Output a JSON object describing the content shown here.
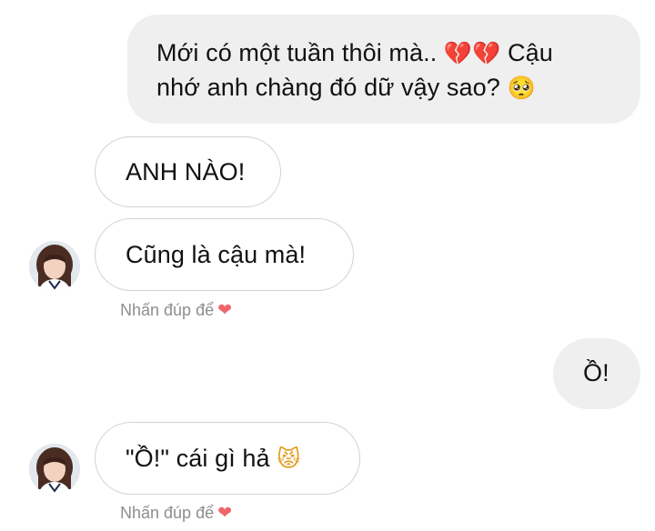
{
  "messages": [
    {
      "side": "outgoing",
      "line1_text": "Mới có một tuần thôi mà.. ",
      "line1_emoji": "💔💔",
      "line1_tail": " Cậu",
      "line2_text": "nhớ anh chàng đó dữ vậy sao? ",
      "line2_emoji": "🥺"
    },
    {
      "side": "incoming",
      "text": "ANH NÀO!"
    },
    {
      "side": "incoming",
      "text": "Cũng là cậu mà!"
    },
    {
      "side": "outgoing",
      "text": "Ồ!"
    },
    {
      "side": "incoming",
      "text": "\"Ồ!\" cái gì hả ",
      "emoji": "😾"
    }
  ],
  "hints": {
    "double_tap_label": "Nhấn đúp để",
    "heart_glyph": "❤"
  },
  "colors": {
    "outgoing_bubble": "#efefef",
    "incoming_border": "#d2d2d2",
    "hint_text": "#8e8e8e",
    "heart": "#f0656c"
  }
}
